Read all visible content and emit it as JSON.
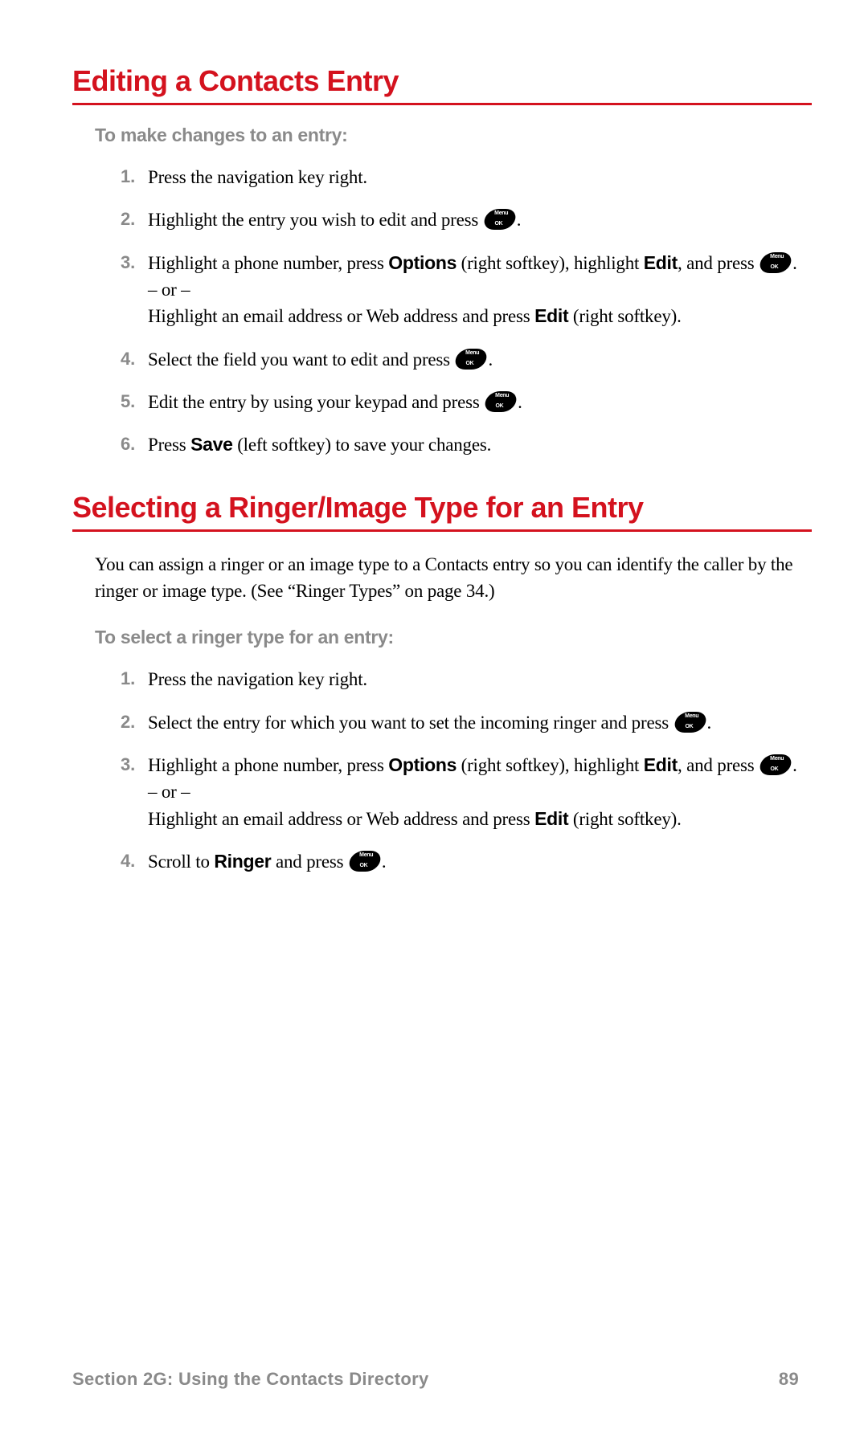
{
  "section1": {
    "heading": "Editing a Contacts Entry",
    "sub": "To make changes to an entry:",
    "steps": [
      {
        "n": "1.",
        "t1": "Press the navigation key right."
      },
      {
        "n": "2.",
        "t1": "Highlight the entry you wish to edit and press ",
        "t2": "."
      },
      {
        "n": "3.",
        "t1": "Highlight a phone number, press ",
        "b1": "Options",
        "t2": " (right softkey), highlight ",
        "b2": "Edit",
        "t3": ", and press ",
        "t4": ".",
        "or": "– or –",
        "t5": "Highlight an email address or Web address and press ",
        "b3": "Edit",
        "t6": " (right softkey)."
      },
      {
        "n": "4.",
        "t1": "Select the field you want to edit and press ",
        "t2": "."
      },
      {
        "n": "5.",
        "t1": "Edit the entry by using your keypad and press ",
        "t2": "."
      },
      {
        "n": "6.",
        "t1": "Press ",
        "b1": "Save",
        "t2": " (left softkey) to save your changes."
      }
    ]
  },
  "section2": {
    "heading": "Selecting a Ringer/Image Type for an Entry",
    "intro": "You can assign a ringer or an image type to a Contacts entry so you can identify the caller by the ringer or image type. (See “Ringer Types” on page 34.)",
    "sub": "To select a ringer type for an entry:",
    "steps": [
      {
        "n": "1.",
        "t1": "Press the navigation key right."
      },
      {
        "n": "2.",
        "t1": "Select the entry for which you want to set the incoming ringer and press ",
        "t2": "."
      },
      {
        "n": "3.",
        "t1": "Highlight a phone number, press ",
        "b1": "Options",
        "t2": " (right softkey), highlight ",
        "b2": "Edit",
        "t3": ", and press ",
        "t4": ".",
        "or": "– or –",
        "t5": "Highlight an email address or Web address and press ",
        "b3": "Edit",
        "t6": " (right softkey)."
      },
      {
        "n": "4.",
        "t1": "Scroll to ",
        "b1": "Ringer",
        "t2": " and press ",
        "t3": "."
      }
    ]
  },
  "footer": {
    "left": "Section 2G: Using the Contacts Directory",
    "right": "89"
  }
}
